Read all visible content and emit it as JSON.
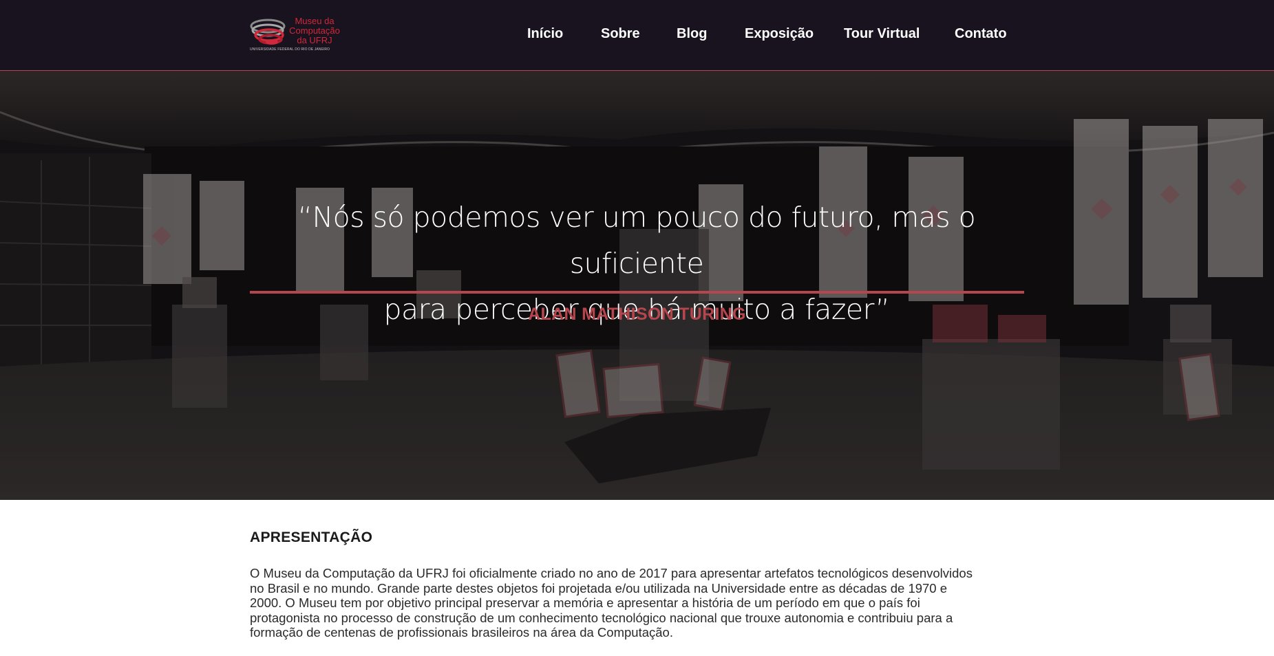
{
  "brand": {
    "logo_line1": "Museu da",
    "logo_line2": "Computação",
    "logo_line3": "da UFRJ",
    "logo_subtitle": "UNIVERSIDADE FEDERAL DO RIO DE JANEIRO",
    "accent_color": "#b5464e",
    "logo_color": "#d0293a"
  },
  "nav": {
    "items": [
      {
        "label": "Início"
      },
      {
        "label": "Sobre"
      },
      {
        "label": "Blog"
      },
      {
        "label": "Exposição"
      },
      {
        "label": "Tour Virtual"
      },
      {
        "label": "Contato"
      }
    ],
    "background": "#19121f"
  },
  "hero": {
    "quote_line1": "“Nós só podemos ver um pouco do futuro, mas o suficiente",
    "quote_line2": "para perceber que há muito a fazer”",
    "author": "ALAN MATHISON TURING"
  },
  "presentation": {
    "title": "APRESENTAÇÃO",
    "lines": [
      "O Museu da Computação da UFRJ foi oficialmente criado no ano de 2017 para apresentar artefatos tecnológicos desenvolvidos",
      "no Brasil e no mundo. Grande parte destes objetos foi projetada e/ou utilizada na Universidade entre as décadas de 1970 e",
      "2000. O Museu tem por objetivo principal preservar a memória e apresentar a história de um período em que o país foi",
      "protagonista no processo de construção de um conhecimento tecnológico nacional que trouxe autonomia e contribuiu para a",
      "formação de centenas de profissionais brasileiros na área da Computação."
    ]
  }
}
